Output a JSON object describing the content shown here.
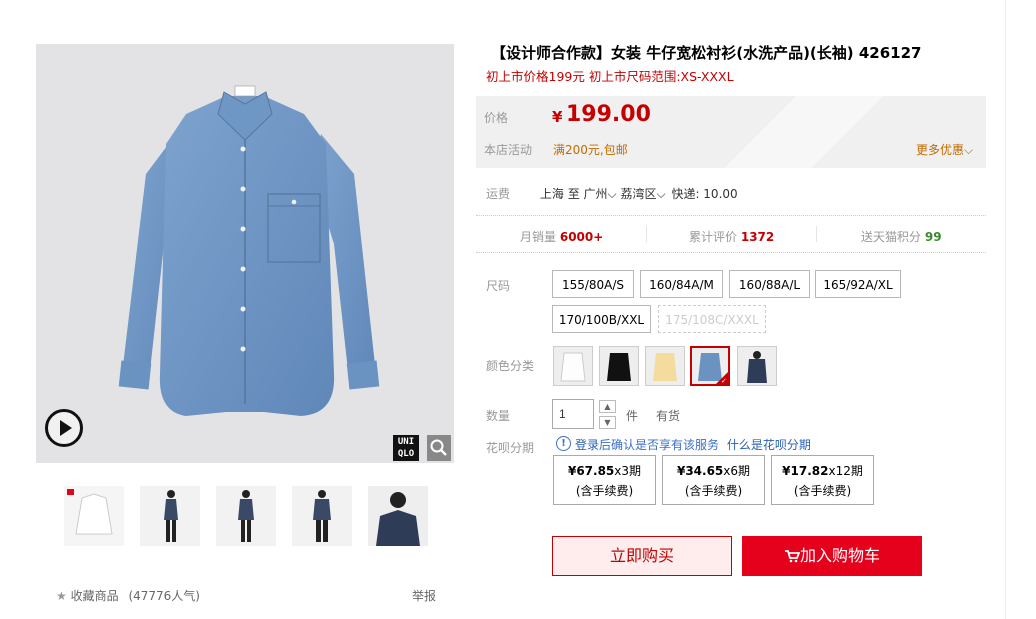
{
  "product": {
    "title": "【设计师合作款】女装 牛仔宽松衬衫(水洗产品)(长袖) 426127",
    "subtitle": "初上市价格199元 初上市尺码范围:XS-XXXL"
  },
  "price_panel": {
    "price_label": "价格",
    "currency": "¥",
    "price": "199.00",
    "promo_label": "本店活动",
    "promo_text": "满200元,包邮",
    "more_label": "更多优惠"
  },
  "shipping": {
    "label": "运费",
    "from": "上海",
    "to_word": "至",
    "city": "广州",
    "district": "荔湾区",
    "fee": "快递: 10.00"
  },
  "stats": {
    "monthly_label": "月销量",
    "monthly_value": "6000+",
    "reviews_label": "累计评价",
    "reviews_value": "1372",
    "points_label": "送天猫积分",
    "points_value": "99"
  },
  "size": {
    "label": "尺码",
    "options": [
      "155/80A/S",
      "160/84A/M",
      "160/88A/L",
      "165/92A/XL",
      "170/100B/XXL",
      "175/108C/XXXL"
    ]
  },
  "color": {
    "label": "颜色分类",
    "swatches": [
      "white-shirt",
      "black-shirt",
      "yellow-shirt",
      "denim-shirt",
      "navy-shirt"
    ],
    "selected_index": 3
  },
  "quantity": {
    "label": "数量",
    "value": "1",
    "unit": "件",
    "stock": "有货"
  },
  "huabei": {
    "label": "花呗分期",
    "notice_login": "登录",
    "notice_text": "后确认是否享有该服务",
    "notice_link": "什么是花呗分期",
    "plans": [
      {
        "amount": "¥67.85",
        "periods": "x3期",
        "fee": "(含手续费)"
      },
      {
        "amount": "¥34.65",
        "periods": "x6期",
        "fee": "(含手续费)"
      },
      {
        "amount": "¥17.82",
        "periods": "x12期",
        "fee": "(含手续费)"
      }
    ]
  },
  "actions": {
    "buy_now": "立即购买",
    "add_to_cart": "加入购物车"
  },
  "gallery": {
    "logo_text_top": "UNI",
    "logo_text_bottom": "QLO",
    "favorite_label": "收藏商品",
    "favorite_count": "(47776人气)",
    "report_label": "举报"
  },
  "colors": {
    "accent_red": "#c40000",
    "cart_red": "#e5001c",
    "promo_orange": "#c06b00",
    "denim": "#6b93c2",
    "link_blue": "#2a5fb0",
    "green_points": "#3a8a2a"
  }
}
